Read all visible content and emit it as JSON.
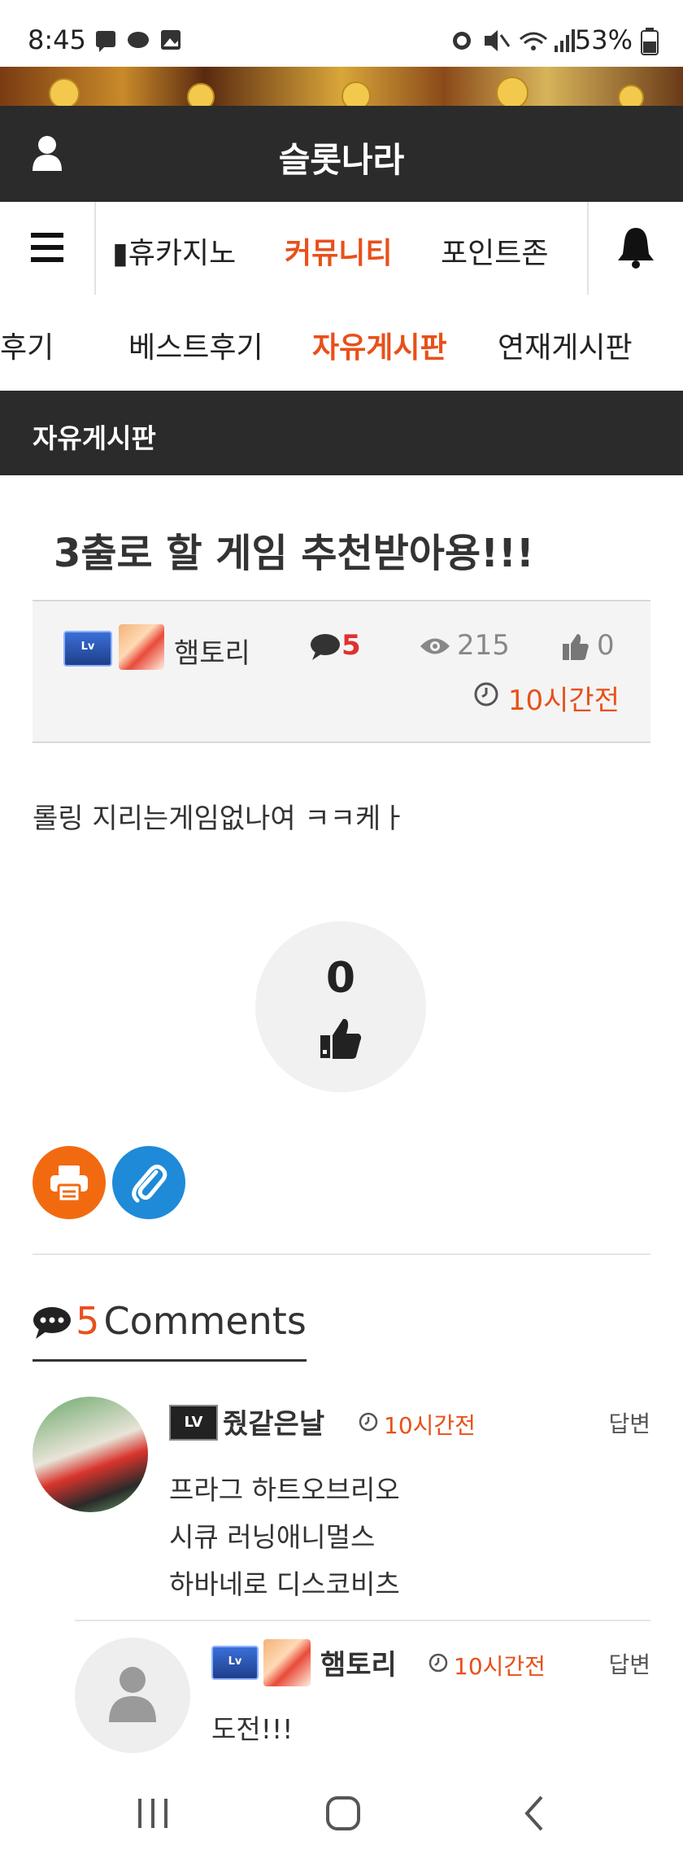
{
  "status_bar": {
    "time": "8:45",
    "battery": "53%"
  },
  "header": {
    "title": "슬롯나라"
  },
  "nav": {
    "items": [
      "▮휴카지노",
      "커뮤니티",
      "포인트존"
    ],
    "active": "커뮤니티"
  },
  "subnav": {
    "items": [
      "후기",
      "베스트후기",
      "자유게시판",
      "연재게시판"
    ],
    "active": "자유게시판"
  },
  "board": {
    "name": "자유게시판"
  },
  "post": {
    "title": "3출로 할 게임 추천받아용!!!",
    "author": "햄토리",
    "comment_count": "5",
    "views": "215",
    "likes": "0",
    "time": "10시간전",
    "body": "롤링 지리는게임없나여 ㅋㅋ케ㅏ",
    "like_button_count": "0"
  },
  "comments_section": {
    "count": "5",
    "label": "Comments"
  },
  "comments": [
    {
      "author": "줬같은날",
      "time": "10시간전",
      "reply_label": "답변",
      "lines": [
        "프라그 하트오브리오",
        "시큐 러닝애니멀스",
        "하바네로 디스코비츠"
      ]
    },
    {
      "author": "햄토리",
      "time": "10시간전",
      "reply_label": "답변",
      "lines": [
        "도전!!!"
      ]
    }
  ],
  "colors": {
    "accent": "#e8501a",
    "header_bg": "#2b2b2b",
    "print_btn": "#f26a10",
    "link_btn": "#1f8ad8"
  },
  "icons": [
    "user-icon",
    "menu-icon",
    "bell-icon",
    "comment-icon",
    "eye-icon",
    "thumbs-up-icon",
    "clock-icon",
    "print-icon",
    "paperclip-icon"
  ]
}
